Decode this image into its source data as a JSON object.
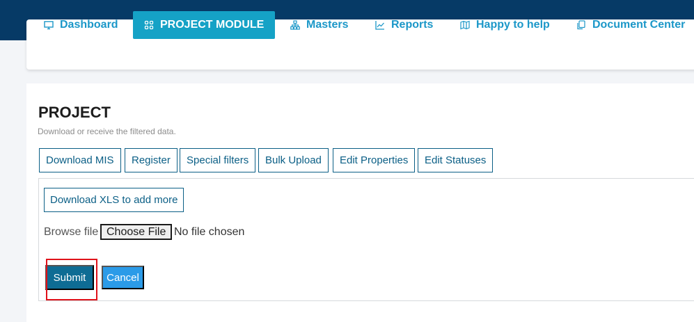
{
  "nav": {
    "items": [
      {
        "label": "Dashboard",
        "icon": "monitor-icon"
      },
      {
        "label": "PROJECT MODULE",
        "icon": "grid-icon",
        "active": true
      },
      {
        "label": "Masters",
        "icon": "hierarchy-icon"
      },
      {
        "label": "Reports",
        "icon": "line-chart-icon"
      },
      {
        "label": "Happy to help",
        "icon": "map-icon"
      },
      {
        "label": "Document Center",
        "icon": "documents-icon"
      }
    ]
  },
  "page": {
    "title": "PROJECT",
    "subtitle": "Download or receive the filtered data."
  },
  "actions": {
    "download_mis": "Download MIS",
    "register": "Register",
    "special_filters": "Special filters",
    "bulk_upload": "Bulk Upload",
    "edit_properties": "Edit Properties",
    "edit_statuses": "Edit Statuses"
  },
  "upload": {
    "download_xls": "Download XLS to add more",
    "browse_label": "Browse file",
    "choose_file": "Choose File",
    "no_file": "No file chosen",
    "submit": "Submit",
    "cancel": "Cancel"
  },
  "colors": {
    "topbar": "#063a66",
    "accent": "#15a2c6",
    "primary_dark": "#0e6c94",
    "cancel": "#2b9be8",
    "highlight": "#e0121a"
  }
}
